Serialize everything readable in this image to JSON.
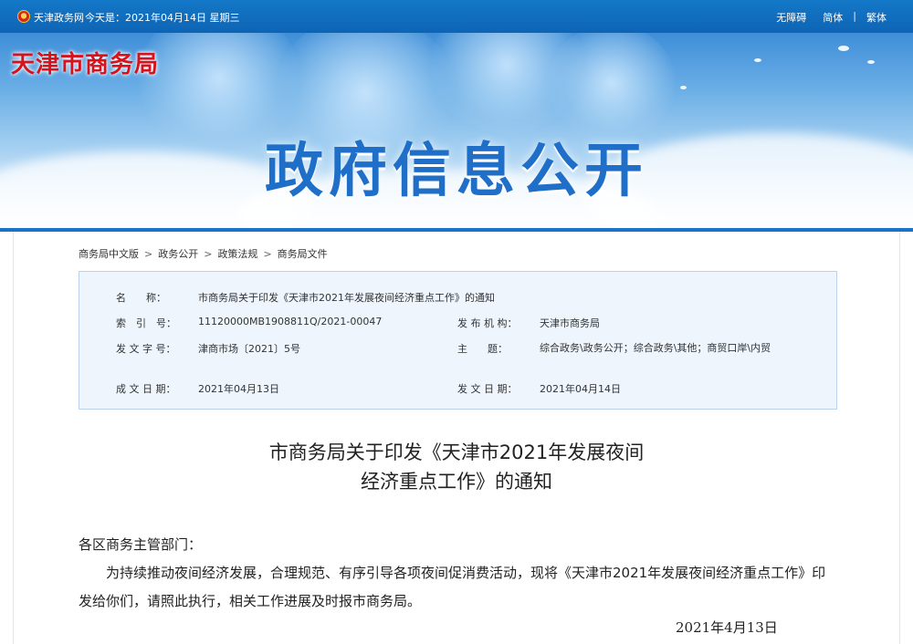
{
  "topbar": {
    "site_name": "天津政务网",
    "today": "今天是：2021年04月14日 星期三",
    "links": [
      "无障碍",
      "简体",
      "繁体"
    ]
  },
  "banner": {
    "brand": "天津市商务局",
    "headline": "政府信息公开"
  },
  "breadcrumb": [
    "商务局中文版",
    "政务公开",
    "政策法规",
    "商务局文件"
  ],
  "meta": {
    "name_label": "名　　称：",
    "name": "市商务局关于印发《天津市2021年发展夜间经济重点工作》的通知",
    "index_label": "索　引　号：",
    "index": "11120000MB1908811Q/2021-00047",
    "publisher_label": "发 布 机 构：",
    "publisher": "天津市商务局",
    "docno_label": "发 文 字 号：",
    "docno": "津商市场〔2021〕5号",
    "subject_label": "主　　题：",
    "subject": "综合政务\\政务公开；综合政务\\其他；商贸口岸\\内贸",
    "written_label": "成 文 日 期：",
    "written": "2021年04月13日",
    "issued_label": "发 文 日 期：",
    "issued": "2021年04月14日"
  },
  "article": {
    "title_line1": "市商务局关于印发《天津市2021年发展夜间",
    "title_line2": "经济重点工作》的通知",
    "salutation": "各区商务主管部门：",
    "paragraph": "为持续推动夜间经济发展，合理规范、有序引导各项夜间促消费活动，现将《天津市2021年发展夜间经济重点工作》印发给你们，请照此执行，相关工作进展及时报市商务局。",
    "date": "2021年4月13日"
  }
}
